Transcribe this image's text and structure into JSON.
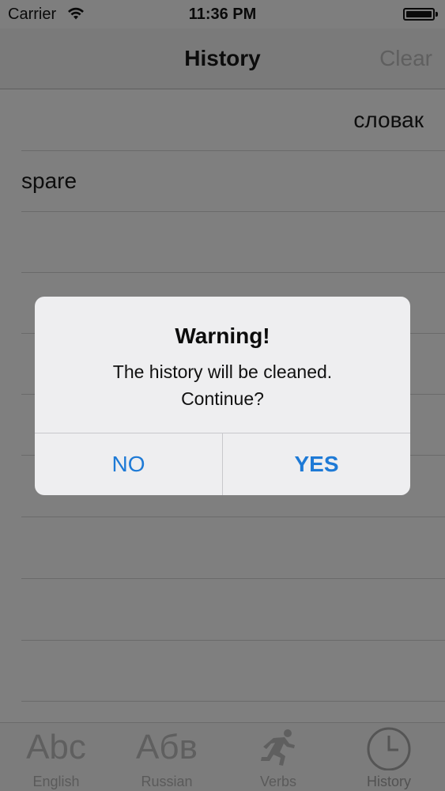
{
  "status_bar": {
    "carrier": "Carrier",
    "time": "11:36 PM",
    "wifi_icon": "wifi-icon",
    "battery_icon": "battery-icon",
    "battery_level": 1.0
  },
  "nav": {
    "title": "History",
    "clear_label": "Clear"
  },
  "history": {
    "items": [
      {
        "text": "словак",
        "align": "right"
      },
      {
        "text": "spare",
        "align": "left"
      },
      {
        "text": ""
      },
      {
        "text": ""
      },
      {
        "text": ""
      },
      {
        "text": ""
      },
      {
        "text": ""
      },
      {
        "text": ""
      },
      {
        "text": ""
      },
      {
        "text": ""
      }
    ]
  },
  "tabs": [
    {
      "label": "English",
      "icon_text": "Abc",
      "icon": "abc-icon"
    },
    {
      "label": "Russian",
      "icon_text": "Абв",
      "icon": "abv-icon"
    },
    {
      "label": "Verbs",
      "icon": "running-man-icon"
    },
    {
      "label": "History",
      "icon": "clock-icon",
      "active": true
    }
  ],
  "alert": {
    "title": "Warning!",
    "message": "The history will be cleaned.\nContinue?",
    "no_label": "NO",
    "yes_label": "YES"
  },
  "colors": {
    "accent": "#1e7ad6",
    "dim_background": "#7f7f7f",
    "dialog_background": "#eeeef0"
  }
}
